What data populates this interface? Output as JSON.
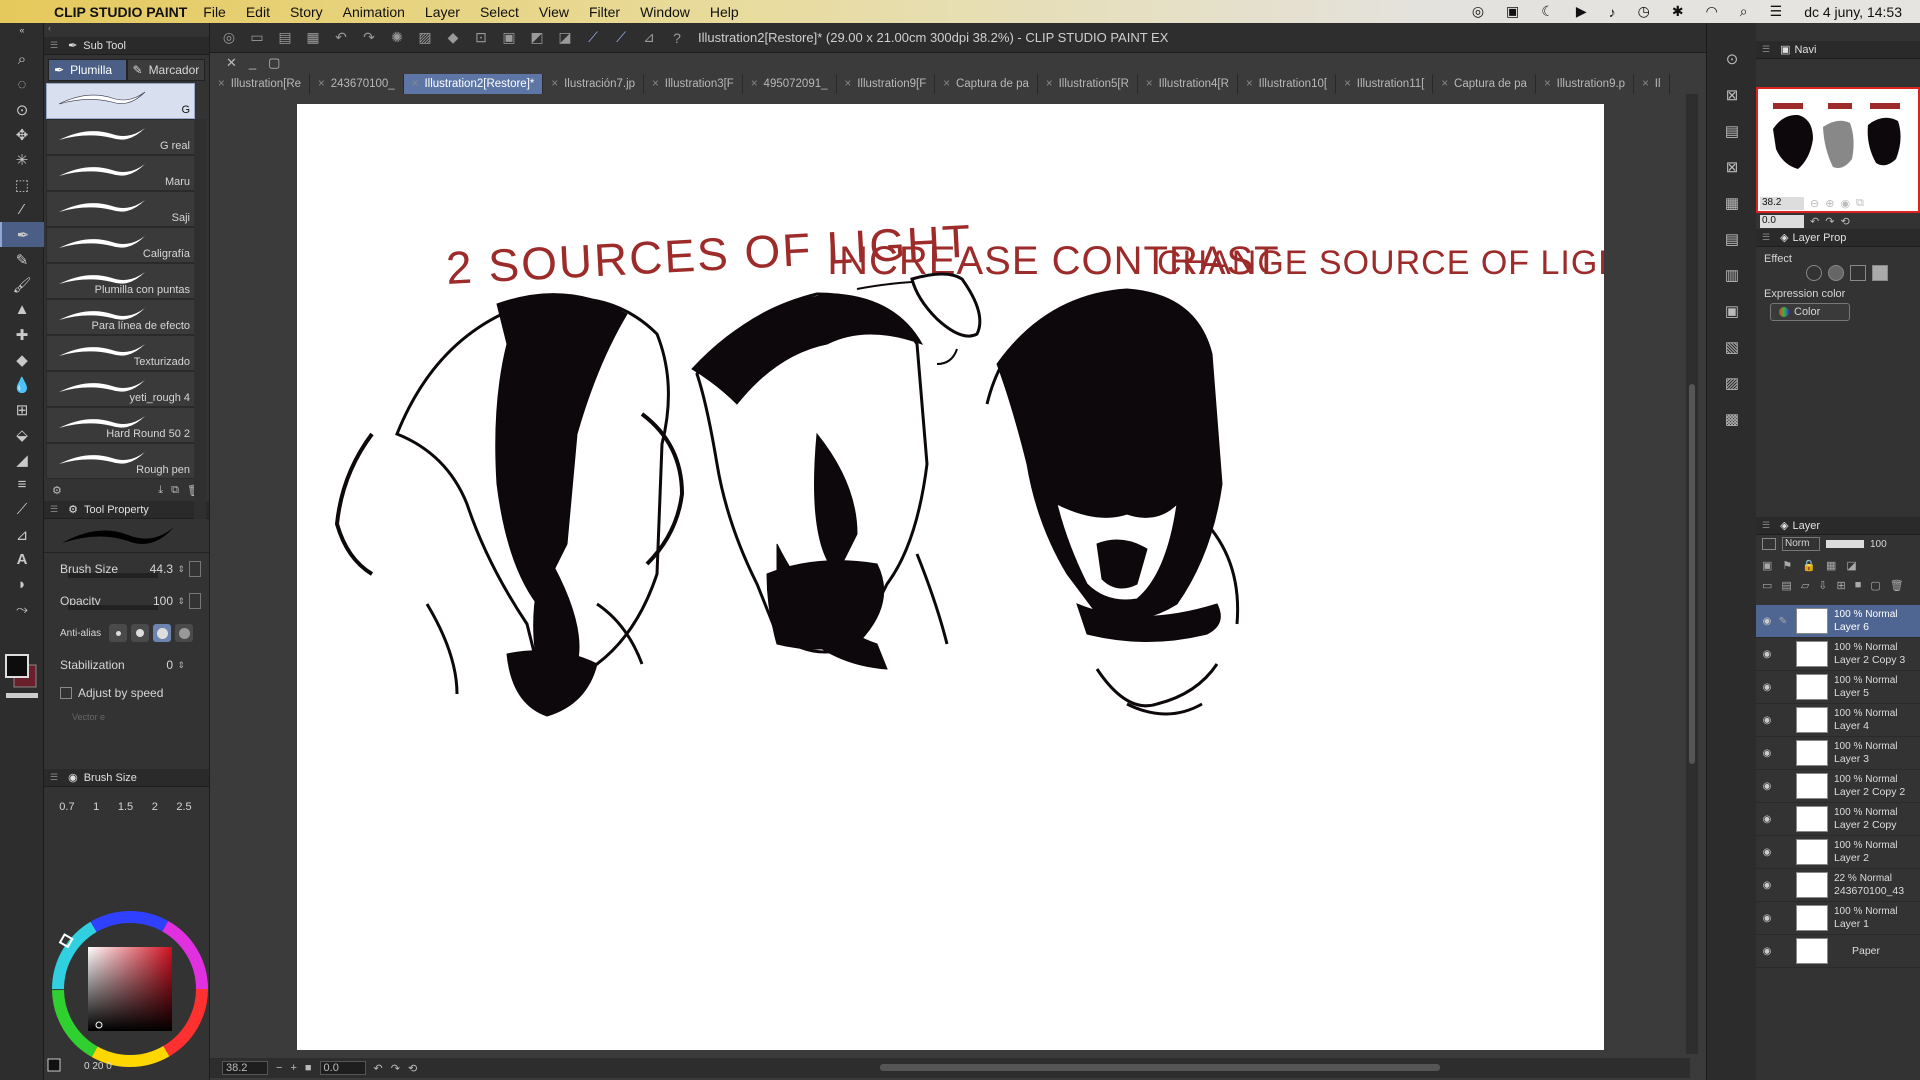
{
  "menubar": {
    "app_name": "CLIP STUDIO PAINT",
    "items": [
      "File",
      "Edit",
      "Story",
      "Animation",
      "Layer",
      "Select",
      "View",
      "Filter",
      "Window",
      "Help"
    ],
    "clock": "dc 4 juny, 14:53"
  },
  "window": {
    "title": "Illustration2[Restore]* (29.00 x 21.00cm 300dpi 38.2%)  - CLIP STUDIO PAINT EX"
  },
  "doc_tabs": [
    {
      "label": "Illustration[Re",
      "selected": false
    },
    {
      "label": "243670100_",
      "selected": false
    },
    {
      "label": "Illustration2[Restore]*",
      "selected": true
    },
    {
      "label": "Ilustración7.jp",
      "selected": false
    },
    {
      "label": "Illustration3[F",
      "selected": false
    },
    {
      "label": "495072091_",
      "selected": false
    },
    {
      "label": "Illustration9[F",
      "selected": false
    },
    {
      "label": "Captura de pa",
      "selected": false
    },
    {
      "label": "Illustration5[R",
      "selected": false
    },
    {
      "label": "Illustration4[R",
      "selected": false
    },
    {
      "label": "Illustration10[",
      "selected": false
    },
    {
      "label": "Illustration11[",
      "selected": false
    },
    {
      "label": "Captura de pa",
      "selected": false
    },
    {
      "label": "Illustration9.p",
      "selected": false
    },
    {
      "label": "Il",
      "selected": false
    }
  ],
  "subtool": {
    "header": "Sub Tool",
    "tabs": [
      "Plumilla",
      "Marcador"
    ],
    "brushes": [
      "G",
      "G real",
      "Maru",
      "Saji",
      "Caligrafía",
      "Plumilla con puntas",
      "Para línea de efecto",
      "Texturizado",
      "yeti_rough 4",
      "Hard Round 50 2",
      "Rough pen"
    ]
  },
  "tool_property": {
    "header": "Tool Property",
    "brush_size_label": "Brush Size",
    "brush_size_value": "44.3",
    "opacity_label": "Opacity",
    "opacity_value": "100",
    "antialias_label": "Anti-alias",
    "stabilization_label": "Stabilization",
    "stabilization_value": "0",
    "adjust_label": "Adjust by speed",
    "vector_label": "Vector e"
  },
  "brush_size_panel": {
    "header": "Brush Size",
    "sizes": [
      "0.7",
      "1",
      "1.5",
      "2",
      "2.5"
    ]
  },
  "color_bottom": {
    "values": "0 20 0"
  },
  "statusbar": {
    "zoom": "38.2",
    "angle": "0.0"
  },
  "navigator": {
    "tab": "Navi",
    "zoom": "38.2",
    "angle": "0.0"
  },
  "layer_property": {
    "tab": "Layer Prop",
    "effect_label": "Effect",
    "expression_label": "Expression color",
    "expression_value": "Color"
  },
  "layer_panel": {
    "tab": "Layer",
    "blend": "Norm",
    "opacity": "100",
    "layers": [
      {
        "opacity": "100 %",
        "mode": "Normal",
        "name": "Layer 6",
        "selected": true
      },
      {
        "opacity": "100 %",
        "mode": "Normal",
        "name": "Layer 2 Copy 3",
        "selected": false
      },
      {
        "opacity": "100 %",
        "mode": "Normal",
        "name": "Layer 5",
        "selected": false
      },
      {
        "opacity": "100 %",
        "mode": "Normal",
        "name": "Layer 4",
        "selected": false
      },
      {
        "opacity": "100 %",
        "mode": "Normal",
        "name": "Layer 3",
        "selected": false
      },
      {
        "opacity": "100 %",
        "mode": "Normal",
        "name": "Layer 2 Copy 2",
        "selected": false
      },
      {
        "opacity": "100 %",
        "mode": "Normal",
        "name": "Layer 2 Copy",
        "selected": false
      },
      {
        "opacity": "100 %",
        "mode": "Normal",
        "name": "Layer 2",
        "selected": false
      },
      {
        "opacity": "22 %",
        "mode": "Normal",
        "name": "243670100_43",
        "selected": false
      },
      {
        "opacity": "100 %",
        "mode": "Normal",
        "name": "Layer 1",
        "selected": false
      },
      {
        "opacity": "",
        "mode": "",
        "name": "Paper",
        "selected": false
      }
    ]
  },
  "canvas_text": {
    "heading1": "2 SOURCES OF LIGHT",
    "heading2": "INCREASE CONTRAST",
    "heading3": "CHANGE SOURCE OF LIGHT"
  },
  "colors": {
    "accent": "#5d76a6",
    "ink": "#0d080b",
    "heading": "#9c2b2a",
    "main_color": "#0d0d0d",
    "sub_color": "#6b1f2a"
  }
}
